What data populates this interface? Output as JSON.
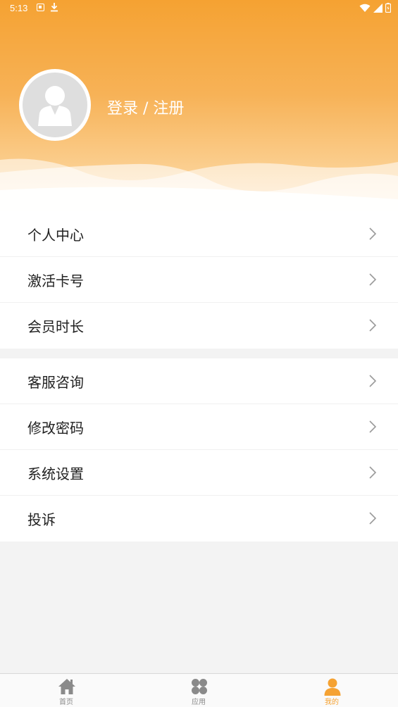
{
  "status_bar": {
    "time": "5:13"
  },
  "profile": {
    "login_label": "登录 / 注册"
  },
  "menu": {
    "group1": [
      {
        "label": "个人中心"
      },
      {
        "label": "激活卡号"
      },
      {
        "label": "会员时长"
      }
    ],
    "group2": [
      {
        "label": "客服咨询"
      },
      {
        "label": "修改密码"
      },
      {
        "label": "系统设置"
      },
      {
        "label": "投诉"
      }
    ]
  },
  "tabbar": {
    "items": [
      {
        "label": "首页",
        "icon": "home-icon"
      },
      {
        "label": "应用",
        "icon": "apps-icon"
      },
      {
        "label": "我的",
        "icon": "person-icon",
        "active": true
      }
    ]
  },
  "colors": {
    "accent": "#f5a232",
    "tab_inactive": "#8a8a8a"
  }
}
